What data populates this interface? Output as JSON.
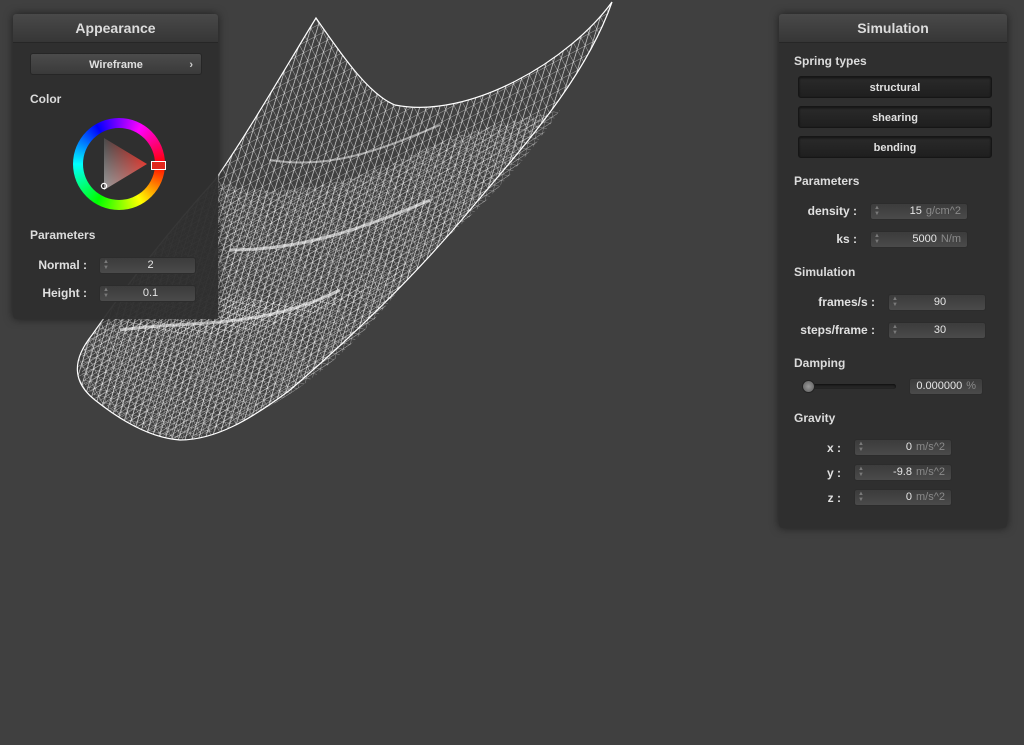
{
  "appearance": {
    "title": "Appearance",
    "render_mode": "Wireframe",
    "color_label": "Color",
    "selected_color": "#e0261c",
    "parameters_label": "Parameters",
    "normal_label": "Normal :",
    "normal_value": "2",
    "height_label": "Height :",
    "height_value": "0.1"
  },
  "simulation": {
    "title": "Simulation",
    "spring_types_label": "Spring types",
    "spring_types": [
      "structural",
      "shearing",
      "bending"
    ],
    "parameters_label": "Parameters",
    "density_label": "density :",
    "density_value": "15",
    "density_unit": "g/cm^2",
    "ks_label": "ks :",
    "ks_value": "5000",
    "ks_unit": "N/m",
    "simulation_label": "Simulation",
    "fps_label": "frames/s :",
    "fps_value": "90",
    "steps_label": "steps/frame :",
    "steps_value": "30",
    "damping_label": "Damping",
    "damping_value": "0.000000",
    "damping_unit": "%",
    "damping_fraction": 0.0,
    "gravity_label": "Gravity",
    "gravity_x_label": "x :",
    "gravity_x_value": "0",
    "gravity_y_label": "y :",
    "gravity_y_value": "-9.8",
    "gravity_z_label": "z :",
    "gravity_z_value": "0",
    "gravity_unit": "m/s^2"
  },
  "viewport": {
    "background_color": "#404040",
    "mesh_color": "#ffffff"
  }
}
